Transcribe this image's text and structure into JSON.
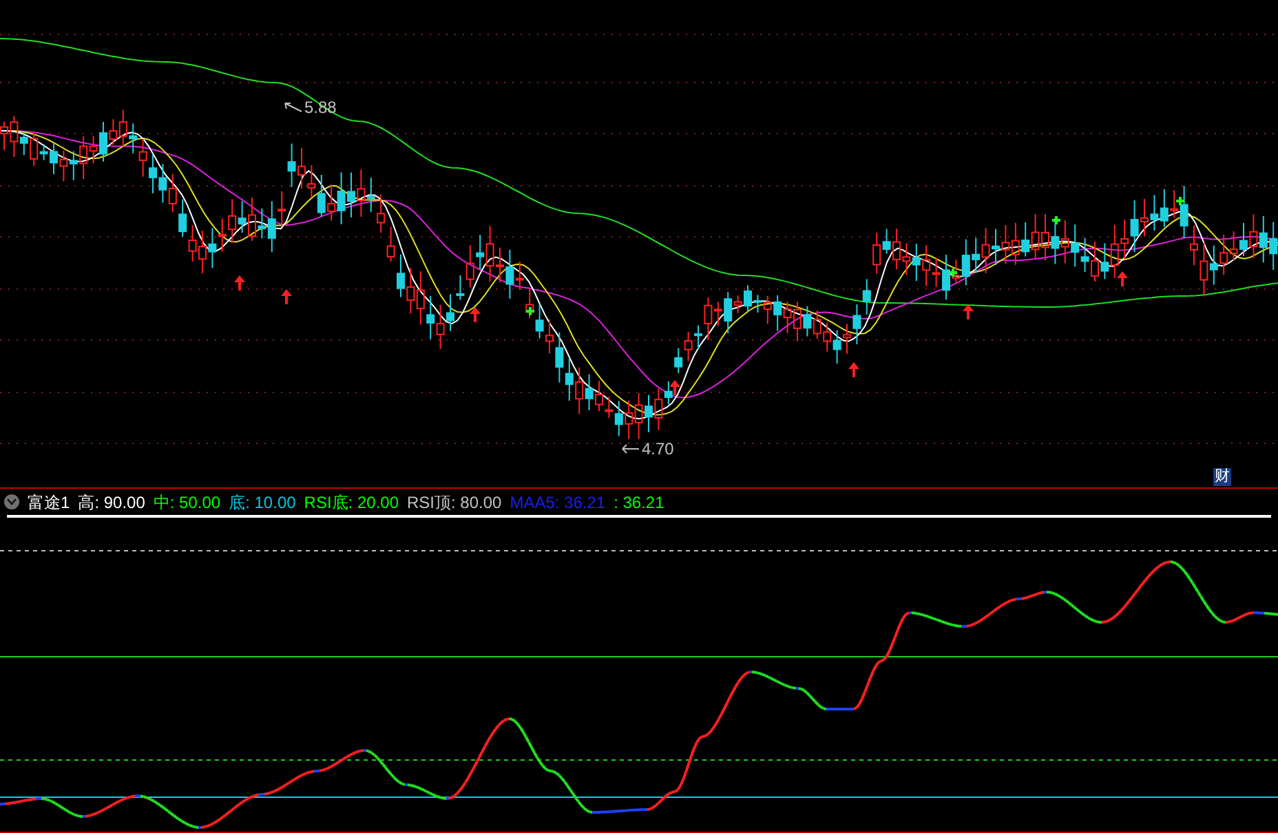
{
  "price_panel": {
    "high_label": "5.88",
    "low_label": "4.70",
    "badge": "财"
  },
  "indicator_legend": {
    "title": "富途1",
    "items": [
      {
        "text": "高: 90.00",
        "color": "#ffffff"
      },
      {
        "text": "中: 50.00",
        "color": "#00ff00"
      },
      {
        "text": "底: 10.00",
        "color": "#00c8e6"
      },
      {
        "text": "RSI底: 20.00",
        "color": "#00ff00"
      },
      {
        "text": "RSI顶: 80.00",
        "color": "#c0c0c0"
      },
      {
        "text": "MAA5: 36.21",
        "color": "#1e1ef0"
      },
      {
        "text": ": 36.21",
        "color": "#00ff00"
      }
    ]
  }
}
